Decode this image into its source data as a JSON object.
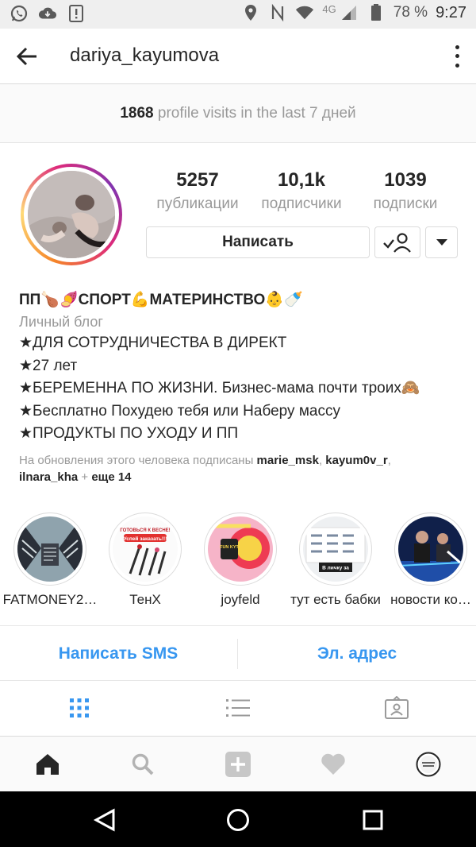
{
  "status_bar": {
    "left_icons": [
      "whatsapp-icon",
      "cloud-download-icon",
      "alert-icon"
    ],
    "network_type": "4G",
    "battery_percent": "78 %",
    "time": "9:27"
  },
  "header": {
    "username": "dariya_kayumova"
  },
  "visits": {
    "count": "1868",
    "text": "profile visits in the last 7 дней"
  },
  "profile": {
    "stats": [
      {
        "value": "5257",
        "label": "публикации"
      },
      {
        "value": "10,1k",
        "label": "подписчики"
      },
      {
        "value": "1039",
        "label": "подписки"
      }
    ],
    "message_button": "Написать"
  },
  "bio": {
    "name": "ПП🍗🍠СПОРТ💪МАТЕРИНСТВО👶🍼",
    "category": "Личный блог",
    "lines": [
      "★ДЛЯ СОТРУДНИЧЕСТВА В ДИРЕКТ",
      "★27 лет",
      "★БЕРЕМЕННА ПО ЖИЗНИ. Бизнес-мама почти троих🙈",
      "★Бесплатно Похудею тебя или Наберу массу",
      "★ПРОДУКТЫ ПО УХОДУ И ПП"
    ],
    "followed_prefix": "На обновления этого человека подписаны",
    "followed_user1": "marie_msk",
    "followed_sep1": ",",
    "followed_user2": "kayum0v_r",
    "followed_sep2": ",",
    "followed_user3": "ilnara_kha",
    "followed_plus": "+",
    "followed_more": "еще 14"
  },
  "highlights": [
    {
      "label": "FATMONEY2…"
    },
    {
      "label": "ТенХ"
    },
    {
      "label": "joyfeld"
    },
    {
      "label": "тут есть бабки"
    },
    {
      "label": "новости ко…"
    }
  ],
  "highlight_texts": {
    "tenx_banner": "ГОТОВЬСЯ К ВЕСНЕ!",
    "tenx_cta": "Успей заказать!!!",
    "joyfeld_badge": "FUN KYT",
    "babki_caption": "В личку за"
  },
  "contact": {
    "sms": "Написать SMS",
    "email": "Эл. адрес"
  },
  "colors": {
    "link_blue": "#3897f0",
    "secondary_text": "#999999",
    "border": "#dbdbdb"
  }
}
